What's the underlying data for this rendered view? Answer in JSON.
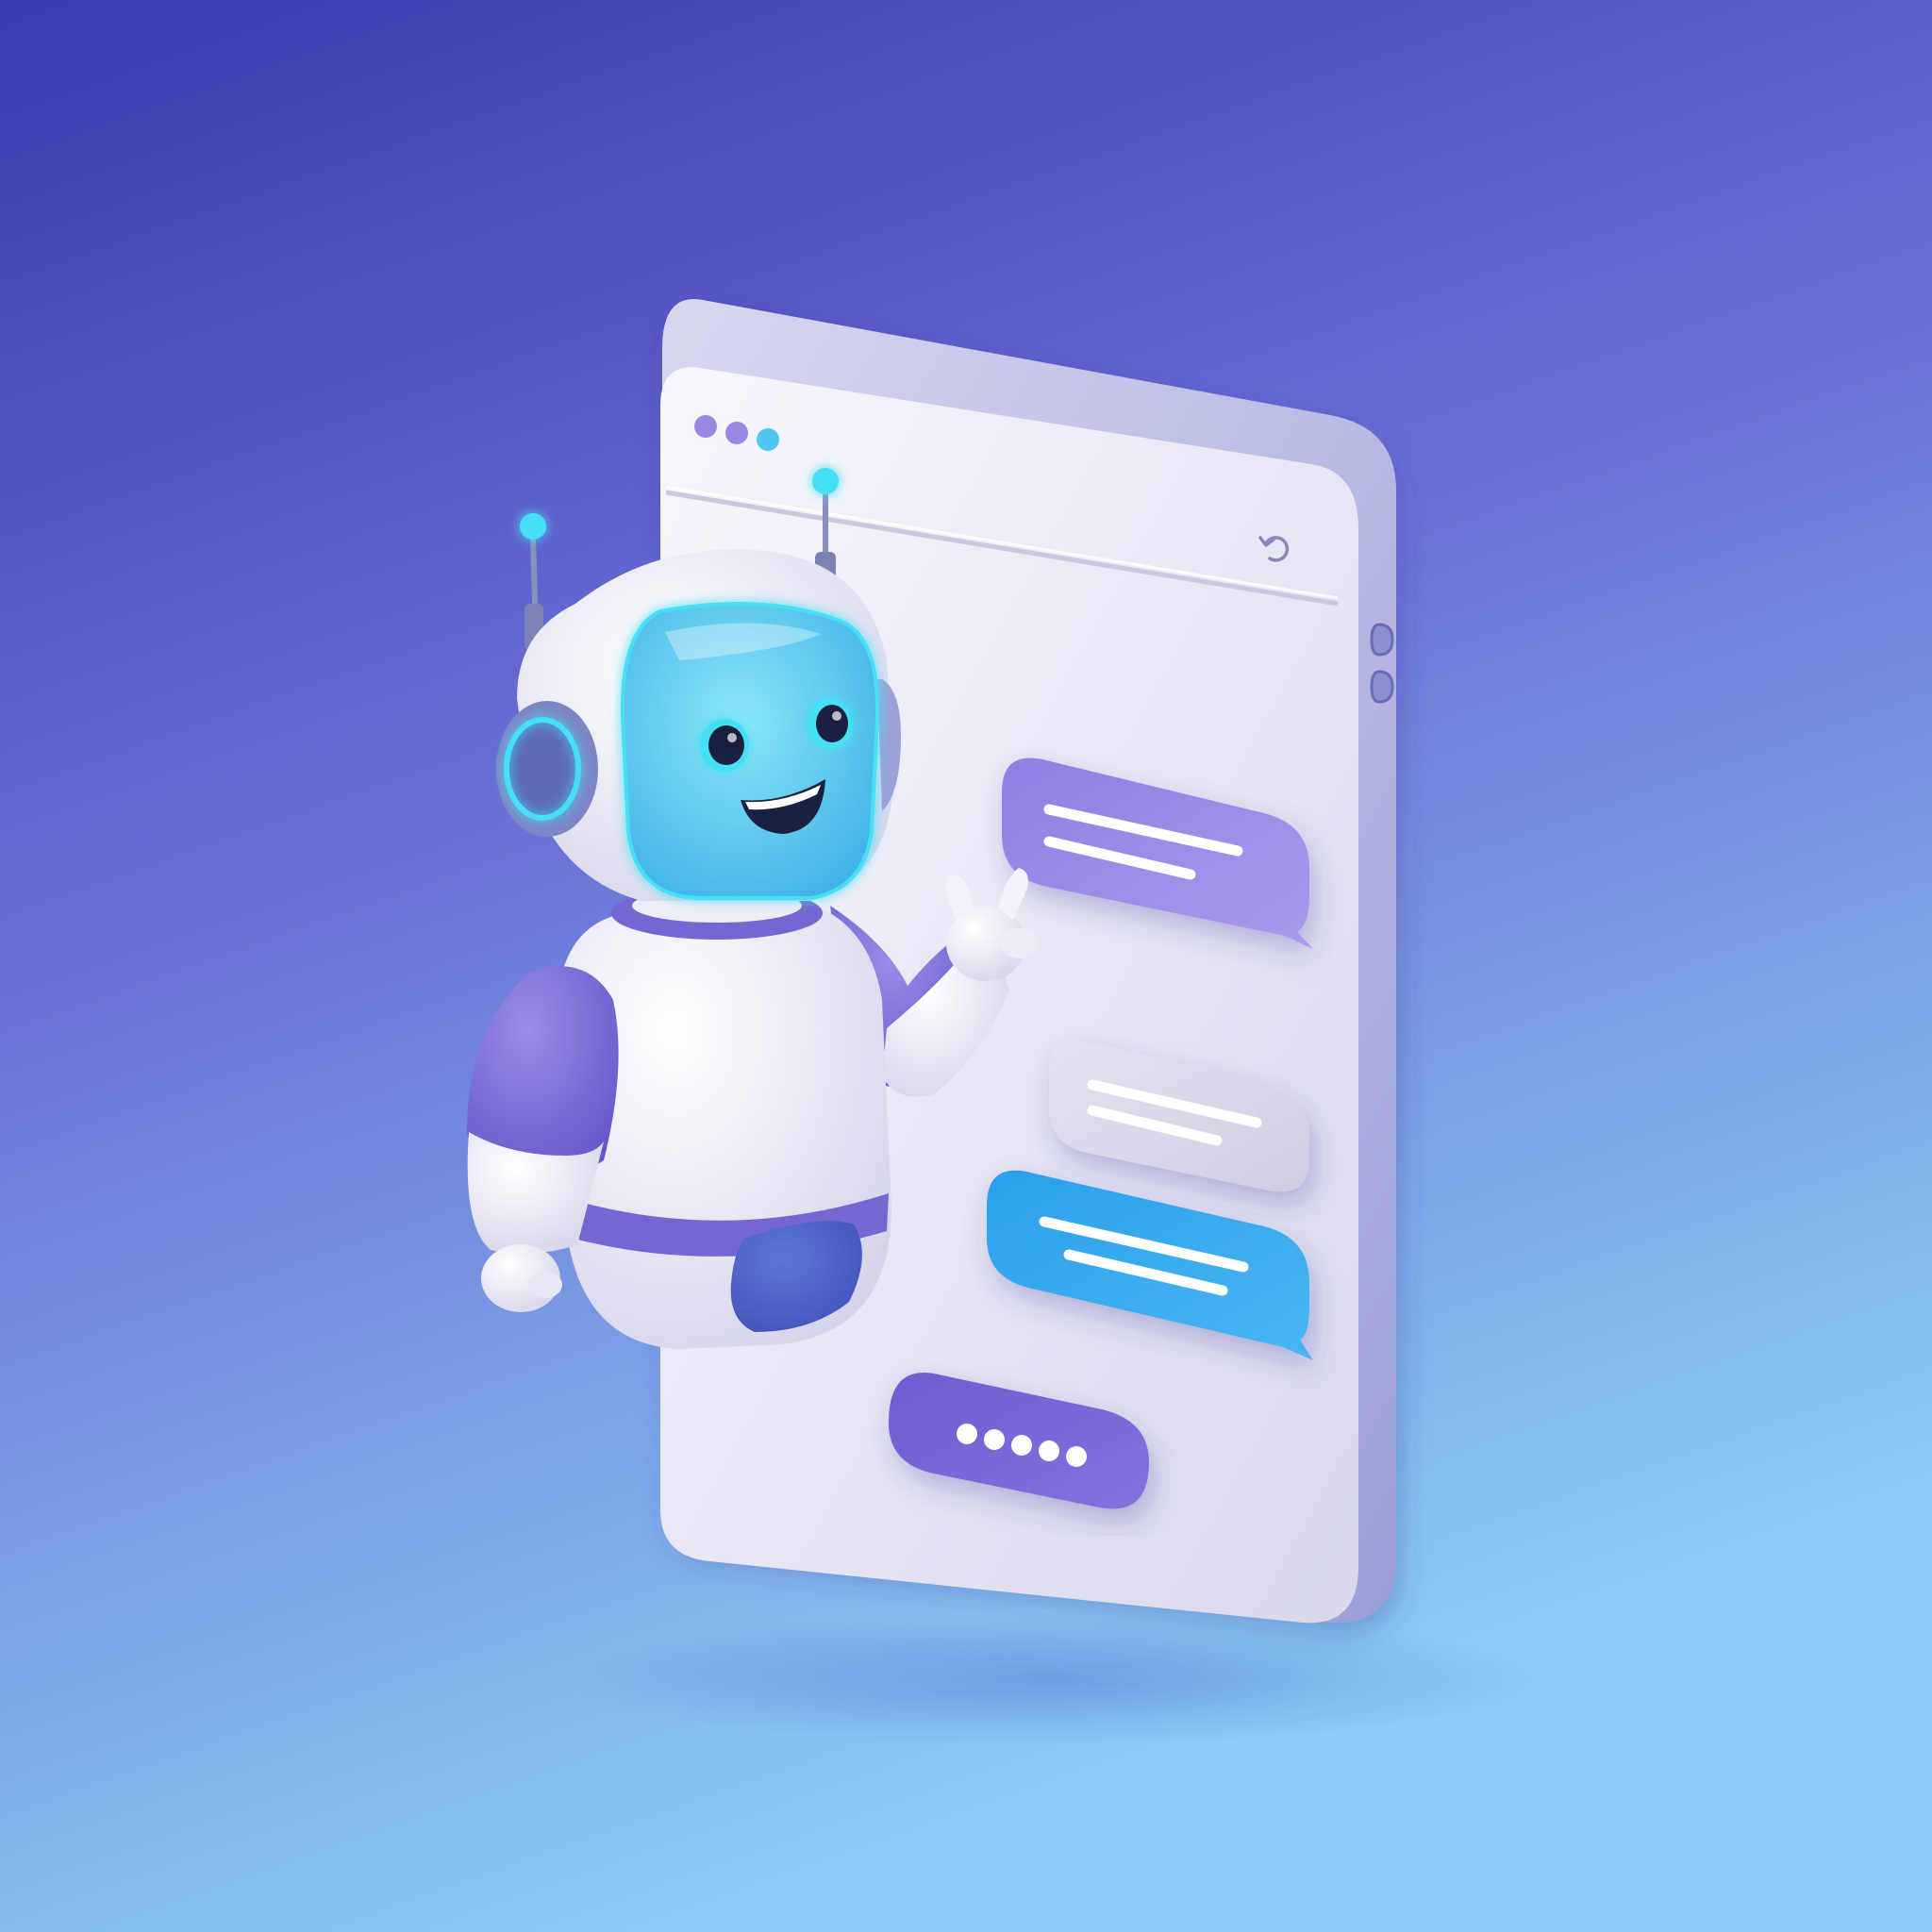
{
  "scene": {
    "subject": "chatbot-robot-beside-chat-window",
    "colors": {
      "background_top": "#3A3BB4",
      "background_mid": "#6C72D8",
      "background_bottom": "#8AC8F2",
      "panel_back": "#B9B9E0",
      "panel_front": "#EEEEF8",
      "bubble_purple": "#9B8AE6",
      "bubble_gray": "#DCDBEA",
      "bubble_blue": "#2FA7EE",
      "input_purple": "#7B68D8",
      "robot_white": "#F4F4FA",
      "robot_purple": "#7A6CD6",
      "visor_cyan": "#5FD3F0",
      "glow_cyan": "#44E0F5"
    },
    "icons": {
      "window_controls": [
        "dot-purple",
        "dot-purple",
        "dot-cyan"
      ],
      "header_action": "refresh-icon",
      "side_buttons": [
        "side-button",
        "side-button"
      ]
    },
    "chat": {
      "bubbles": [
        {
          "style": "purple",
          "line_count": 2
        },
        {
          "style": "gray",
          "line_count": 2
        },
        {
          "style": "blue",
          "line_count": 2
        }
      ],
      "typing_dots": 5
    }
  }
}
